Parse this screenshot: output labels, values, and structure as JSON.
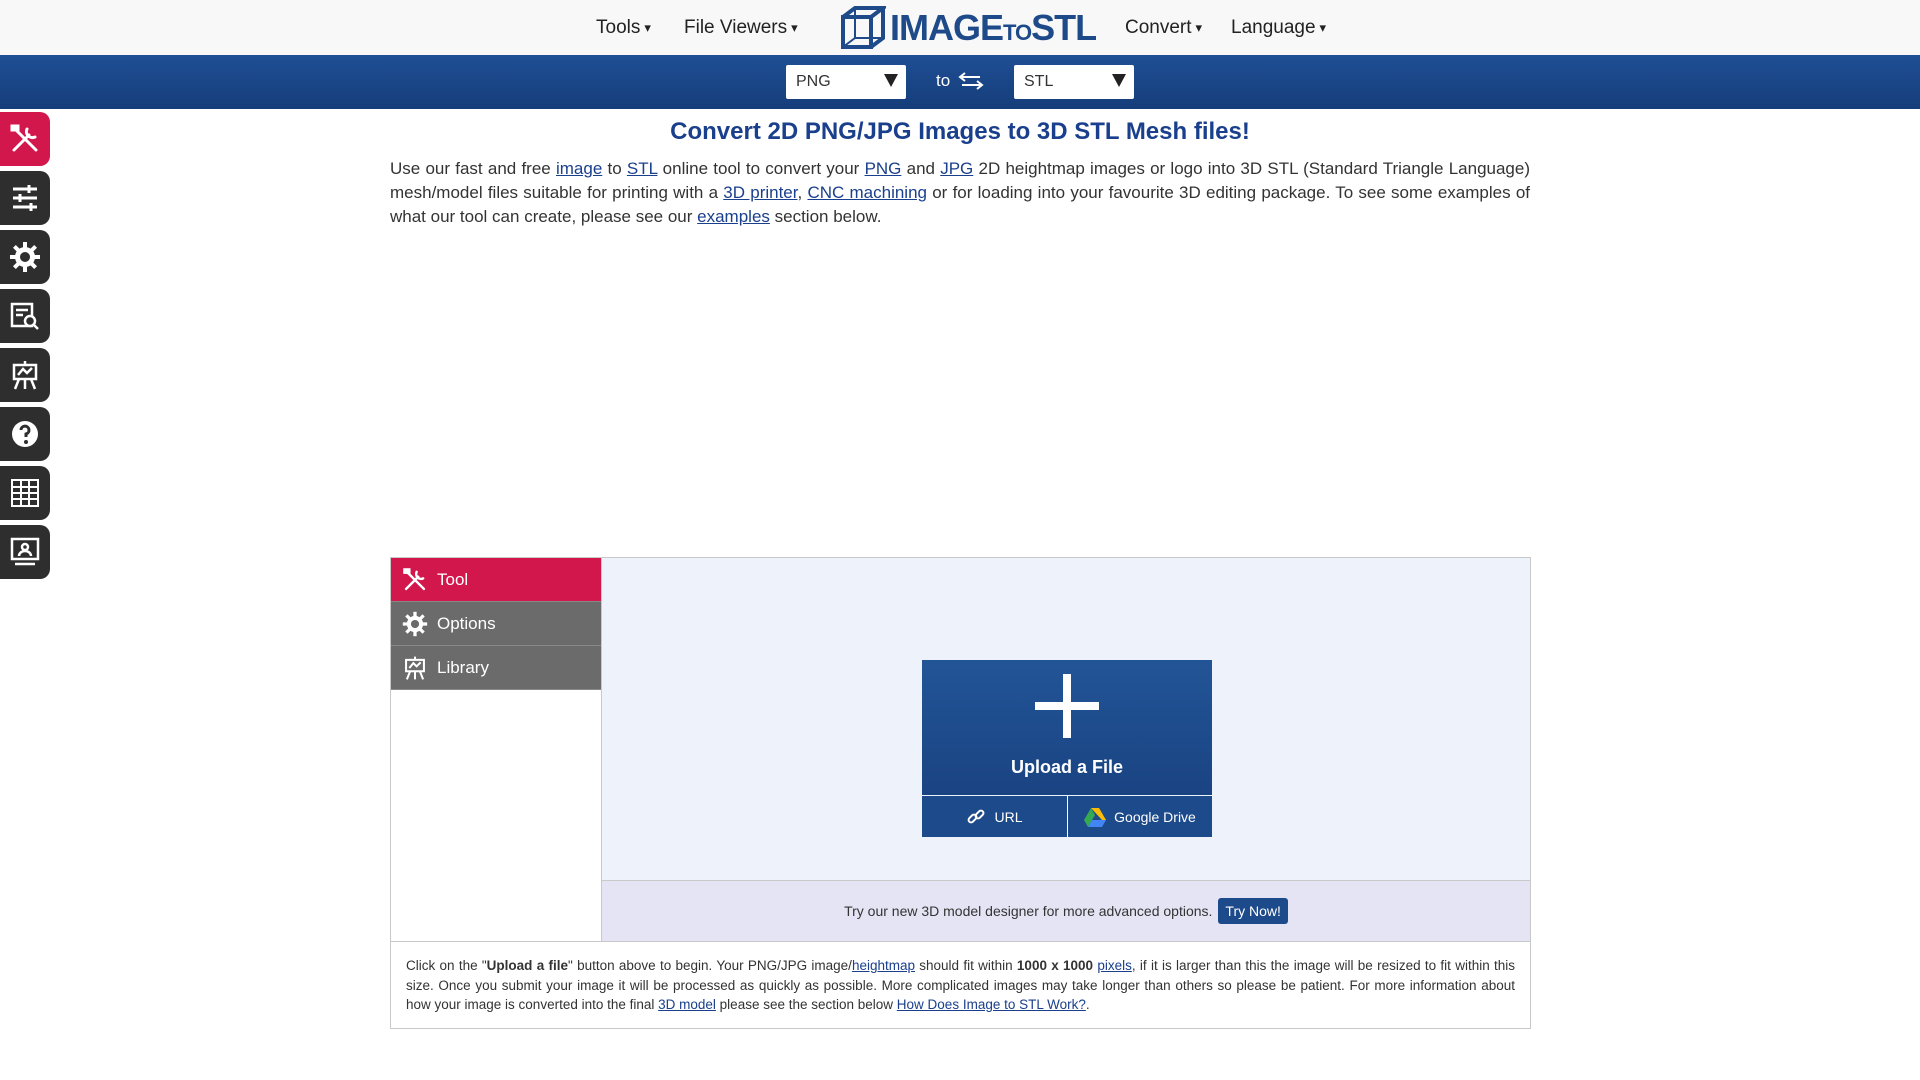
{
  "nav": {
    "tools": "Tools",
    "file_viewers": "File Viewers",
    "convert": "Convert",
    "language": "Language",
    "caret": "▾",
    "logo_main": "IMAGE",
    "logo_mid": "TO",
    "logo_end": "STL"
  },
  "converter": {
    "from_value": "PNG",
    "to_label": "to",
    "to_value": "STL"
  },
  "rail": {
    "items": [
      "tool-icon",
      "sliders-icon",
      "gear-icon",
      "search-document-icon",
      "easel-icon",
      "help-icon",
      "grid-icon",
      "presenter-icon"
    ]
  },
  "heading": "Convert 2D PNG/JPG Images to 3D STL Mesh files!",
  "intro": {
    "t1": "Use our fast and free ",
    "l_image": "image",
    "t2": " to ",
    "l_stl": "STL",
    "t3": " online tool to convert your ",
    "l_png": "PNG",
    "t4": " and ",
    "l_jpg": "JPG",
    "t5": " 2D heightmap images or logo into 3D STL (Standard Triangle Language) mesh/model files suitable for printing with a ",
    "l_printer": "3D printer",
    "t6": ", ",
    "l_cnc": "CNC machining",
    "t7": " or for loading into your favourite 3D editing package. To see some examples of what our tool can create, please see our ",
    "l_examples": "examples",
    "t8": " section below."
  },
  "panel": {
    "tabs": [
      {
        "label": "Tool"
      },
      {
        "label": "Options"
      },
      {
        "label": "Library"
      }
    ],
    "upload_label": "Upload a File",
    "url_label": "URL",
    "gdrive_label": "Google Drive",
    "designer_text": "Try our new 3D model designer for more advanced options.",
    "try_label": "Try Now!"
  },
  "instructions": {
    "t1": "Click on the \"",
    "b1": "Upload a file",
    "t2": "\" button above to begin. Your PNG/JPG image/",
    "l_heightmap": "heightmap",
    "t3": " should fit within ",
    "b2": "1000 x 1000",
    "t4": " ",
    "l_pixels": "pixels",
    "t5": ", if it is larger than this the image will be resized to fit within this size. Once you submit your image it will be processed as quickly as possible. More complicated images may take longer than others so please be patient. For more information about how your image is converted into the final ",
    "l_model": "3D model",
    "t6": " please see the section below ",
    "l_how": "How Does Image to STL Work?",
    "t7": "."
  },
  "colors": {
    "accent_pink": "#d2174c",
    "brand_blue": "#1d4a8a",
    "rail_dark": "#2e2e2e"
  }
}
